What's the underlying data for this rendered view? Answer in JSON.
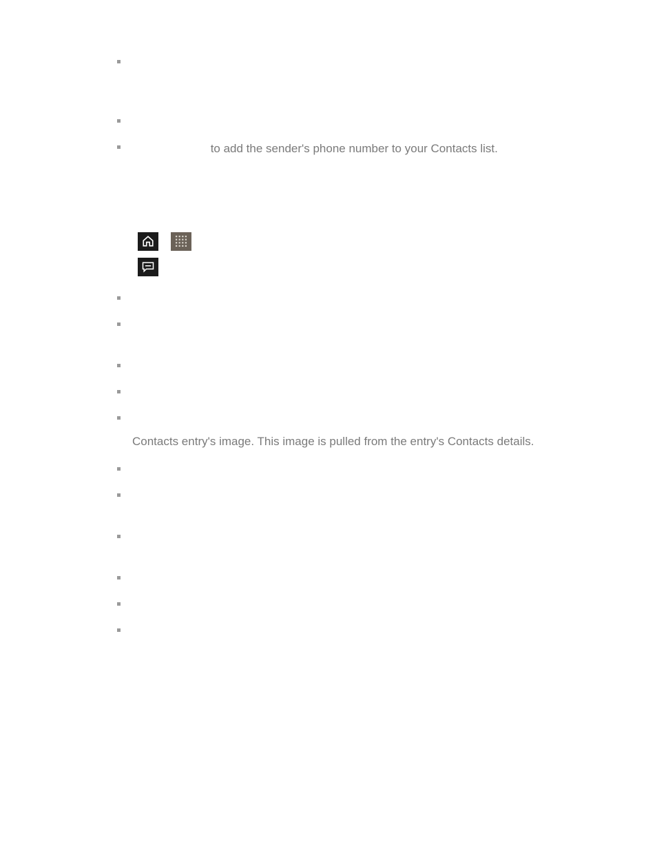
{
  "text_fragments": {
    "bullet_addcontacts": "to add the sender's phone number to your Contacts list.",
    "paragraph_image": "Contacts entry's image. This image is pulled from the entry's Contacts details."
  },
  "icons": {
    "home": "home-icon",
    "grid": "apps-grid-icon",
    "messaging": "messaging-icon"
  }
}
